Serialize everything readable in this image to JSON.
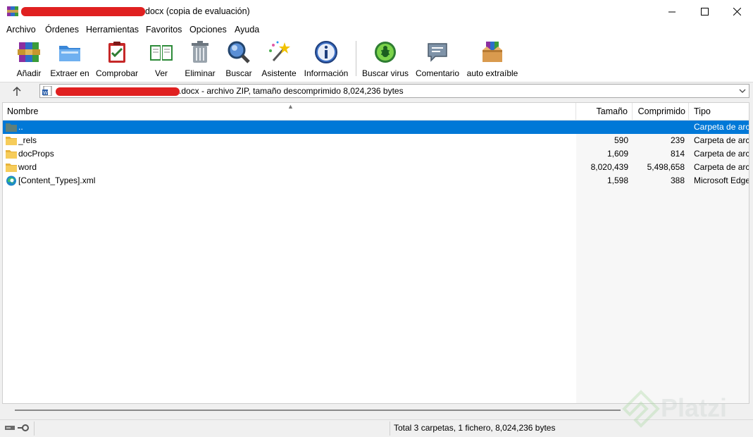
{
  "window": {
    "title": "docx (copia de evaluación)",
    "icon": "winrar-icon"
  },
  "menu": [
    "Archivo",
    "Órdenes",
    "Herramientas",
    "Favoritos",
    "Opciones",
    "Ayuda"
  ],
  "toolbar": [
    {
      "label": "Añadir",
      "icon": "add-icon"
    },
    {
      "label": "Extraer en",
      "icon": "extract-folder-icon"
    },
    {
      "label": "Comprobar",
      "icon": "test-clipboard-icon"
    },
    {
      "label": "Ver",
      "icon": "book-icon"
    },
    {
      "label": "Eliminar",
      "icon": "trash-icon"
    },
    {
      "label": "Buscar",
      "icon": "magnifier-icon"
    },
    {
      "label": "Asistente",
      "icon": "wizard-wand-icon"
    },
    {
      "label": "Información",
      "icon": "info-icon"
    },
    {
      "label": "Buscar virus",
      "icon": "virus-icon"
    },
    {
      "label": "Comentario",
      "icon": "comment-icon"
    },
    {
      "label": "auto extraíble",
      "icon": "sfx-box-icon"
    }
  ],
  "address": {
    "text": ".docx - archivo ZIP, tamaño descomprimido 8,024,236 bytes"
  },
  "columns": {
    "name": "Nombre",
    "size": "Tamaño",
    "packed": "Comprimido",
    "type": "Tipo"
  },
  "files": [
    {
      "name": "..",
      "size": "",
      "packed": "",
      "type": "Carpeta de arch",
      "icon": "folder-up-icon",
      "selected": true
    },
    {
      "name": "_rels",
      "size": "590",
      "packed": "239",
      "type": "Carpeta de arch",
      "icon": "folder-icon"
    },
    {
      "name": "docProps",
      "size": "1,609",
      "packed": "814",
      "type": "Carpeta de arch",
      "icon": "folder-icon"
    },
    {
      "name": "word",
      "size": "8,020,439",
      "packed": "5,498,658",
      "type": "Carpeta de arch",
      "icon": "folder-icon"
    },
    {
      "name": "[Content_Types].xml",
      "size": "1,598",
      "packed": "388",
      "type": "Microsoft Edge",
      "icon": "edge-icon"
    }
  ],
  "status": {
    "text": "Total 3 carpetas, 1 fichero, 8,024,236 bytes"
  },
  "watermark": "Platzi",
  "colors": {
    "selection": "#0078d7",
    "redaction": "#e02020"
  }
}
